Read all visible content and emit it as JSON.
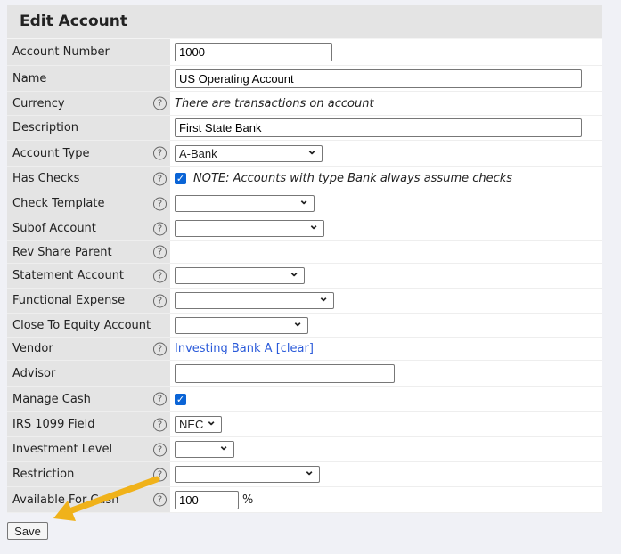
{
  "title": "Edit Account",
  "fields": {
    "account_number": {
      "label": "Account Number",
      "value": "1000"
    },
    "name": {
      "label": "Name",
      "value": "US Operating Account"
    },
    "currency": {
      "label": "Currency",
      "note": "There are transactions on account"
    },
    "description": {
      "label": "Description",
      "value": "First State Bank"
    },
    "account_type": {
      "label": "Account Type",
      "value": "A-Bank"
    },
    "has_checks": {
      "label": "Has Checks",
      "checked": true,
      "note": "NOTE: Accounts with type Bank always assume checks"
    },
    "check_template": {
      "label": "Check Template",
      "value": ""
    },
    "subof_account": {
      "label": "Subof Account",
      "value": ""
    },
    "rev_share_parent": {
      "label": "Rev Share Parent"
    },
    "statement_account": {
      "label": "Statement Account",
      "value": ""
    },
    "functional_expense": {
      "label": "Functional Expense",
      "value": ""
    },
    "close_to_equity": {
      "label": "Close To Equity Account",
      "value": ""
    },
    "vendor": {
      "label": "Vendor",
      "value": "Investing Bank A",
      "clear": "[clear]"
    },
    "advisor": {
      "label": "Advisor",
      "value": ""
    },
    "manage_cash": {
      "label": "Manage Cash",
      "checked": true
    },
    "irs_1099": {
      "label": "IRS 1099 Field",
      "value": "NEC"
    },
    "investment_level": {
      "label": "Investment Level",
      "value": ""
    },
    "restriction": {
      "label": "Restriction",
      "value": ""
    },
    "available_for_cash": {
      "label": "Available For Cash",
      "value": "100",
      "unit": "%"
    }
  },
  "help_icon": "?",
  "check_glyph": "✓",
  "save_label": "Save",
  "colors": {
    "arrow": "#f0b21a",
    "link": "#2a5ad9",
    "checkbox": "#0a64d6"
  }
}
